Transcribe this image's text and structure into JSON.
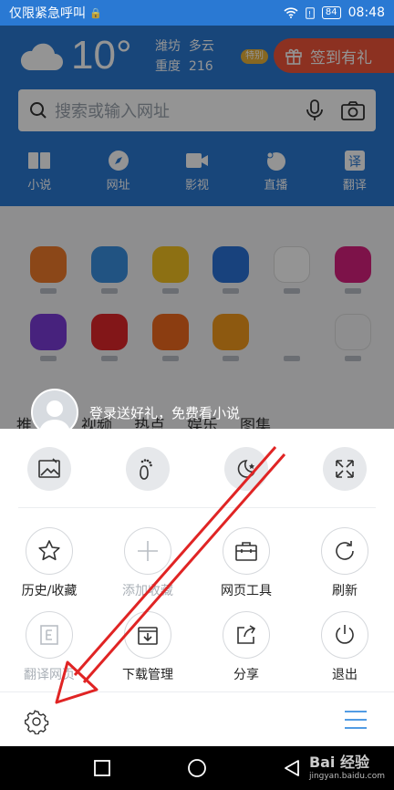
{
  "status": {
    "carrier": "仅限紧急呼叫",
    "battery": "84",
    "time": "08:48"
  },
  "weather": {
    "temp": "10°",
    "city": "潍坊",
    "condition": "多云",
    "aqi_label": "重度",
    "aqi_value": "216",
    "badge": "特别"
  },
  "signin": {
    "label": "签到有礼"
  },
  "search": {
    "placeholder": "搜索或输入网址"
  },
  "nav": [
    {
      "label": "小说",
      "icon": "book-icon"
    },
    {
      "label": "网址",
      "icon": "compass-icon"
    },
    {
      "label": "影视",
      "icon": "video-icon"
    },
    {
      "label": "直播",
      "icon": "live-icon"
    },
    {
      "label": "翻译",
      "icon": "translate-icon"
    }
  ],
  "feed_tabs": [
    "推",
    "视频",
    "热点",
    "娱乐",
    "图集"
  ],
  "login": {
    "text": "登录送好礼，免费看小说"
  },
  "menu": {
    "row1": [
      {
        "label": "历史/收藏",
        "icon": "star-icon",
        "enabled": true
      },
      {
        "label": "添加收藏",
        "icon": "plus-icon",
        "enabled": false
      },
      {
        "label": "网页工具",
        "icon": "toolbox-icon",
        "enabled": true
      },
      {
        "label": "刷新",
        "icon": "refresh-icon",
        "enabled": true
      }
    ],
    "row2": [
      {
        "label": "翻译网页",
        "icon": "translate-page-icon",
        "enabled": false
      },
      {
        "label": "下载管理",
        "icon": "download-icon",
        "enabled": true
      },
      {
        "label": "分享",
        "icon": "share-icon",
        "enabled": true
      },
      {
        "label": "退出",
        "icon": "power-icon",
        "enabled": true
      }
    ]
  },
  "colors": {
    "brand": "#2a79d3",
    "signin": "#f2553a",
    "annotation": "#e02424",
    "accent": "#3a8fe0"
  },
  "watermark": {
    "brand": "Bai 经验",
    "url": "jingyan.baidu.com"
  }
}
